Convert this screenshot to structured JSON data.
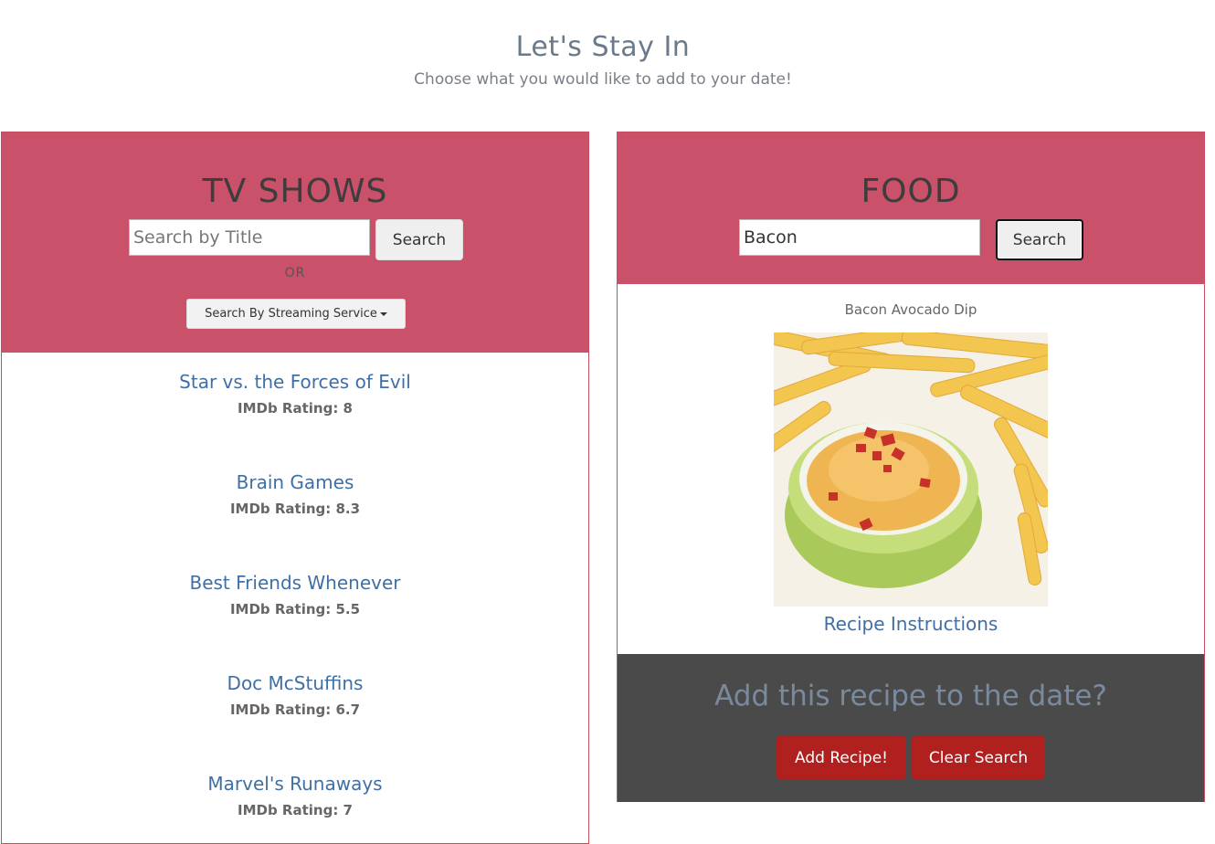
{
  "header": {
    "title": "Let's Stay In",
    "subtitle": "Choose what you would like to add to your date!"
  },
  "tv": {
    "title": "TV SHOWS",
    "search_placeholder": "Search by Title",
    "search_value": "",
    "search_label": "Search",
    "or_label": "OR",
    "dropdown_label": "Search By Streaming Service",
    "shows": [
      {
        "title": "Star vs. the Forces of Evil",
        "rating": "IMDb Rating: 8"
      },
      {
        "title": "Brain Games",
        "rating": "IMDb Rating: 8.3"
      },
      {
        "title": "Best Friends Whenever",
        "rating": "IMDb Rating: 5.5"
      },
      {
        "title": "Doc McStuffins",
        "rating": "IMDb Rating: 6.7"
      },
      {
        "title": "Marvel's Runaways",
        "rating": "IMDb Rating: 7"
      }
    ]
  },
  "food": {
    "title": "FOOD",
    "search_value": "Bacon",
    "search_label": "Search",
    "recipe_name": "Bacon Avocado Dip",
    "recipe_link": "Recipe Instructions",
    "add_question": "Add this recipe to the date?",
    "add_label": "Add Recipe!",
    "clear_label": "Clear Search"
  },
  "colors": {
    "panel_header": "#c9516a",
    "panel_border": "#c94d5f",
    "link": "#3f6fa5",
    "action_button": "#b0201f",
    "add_section_bg": "#4a4a4a"
  }
}
